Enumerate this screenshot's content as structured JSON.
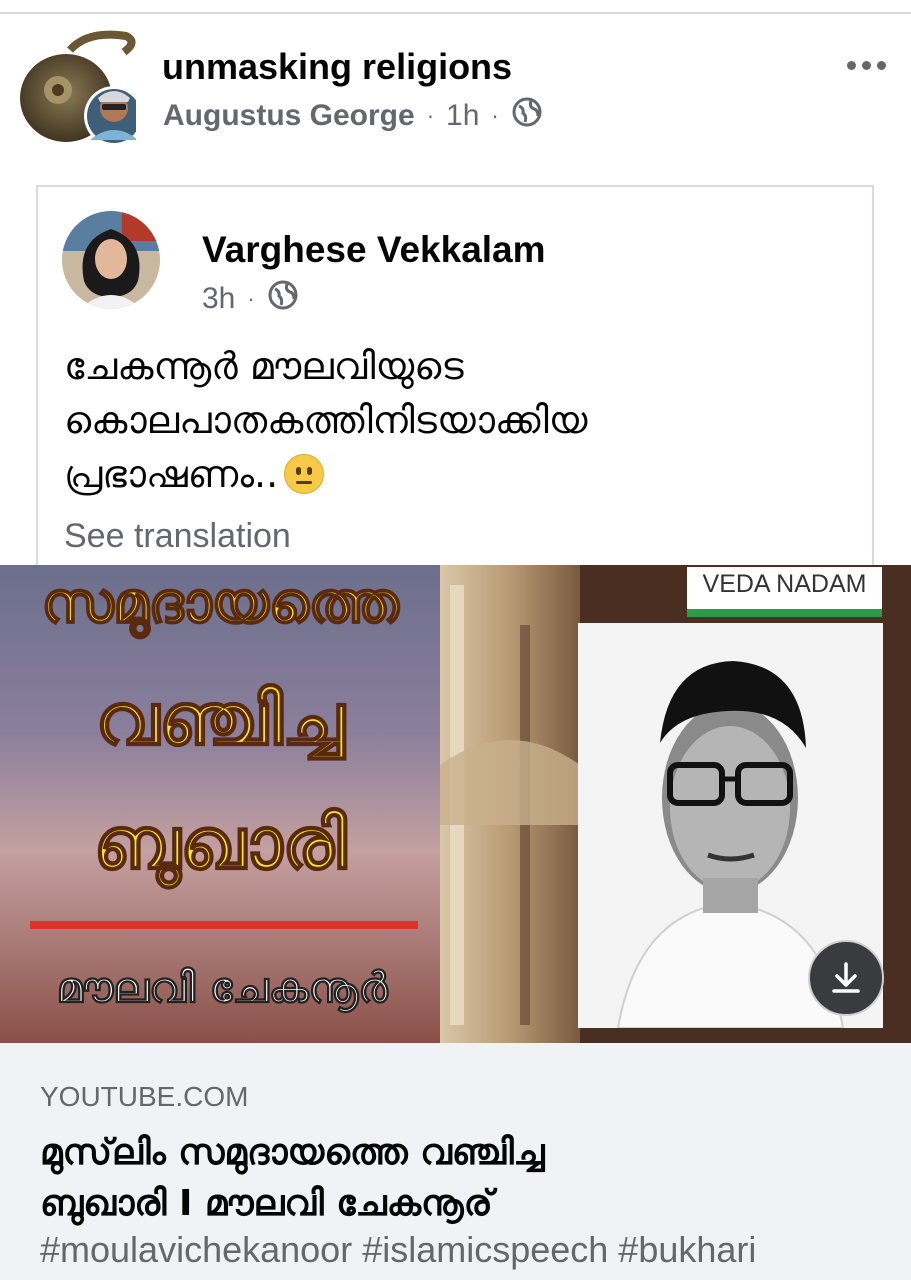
{
  "post": {
    "group_name": "unmasking religions",
    "author": "Augustus George",
    "time": "1h",
    "separator": "·"
  },
  "shared": {
    "name": "Varghese Vekkalam",
    "time": "3h",
    "separator": "·",
    "text_lines": [
      "ചേകന്നൂർ മൗലവിയുടെ",
      "കൊലപാതകത്തിനിടയാക്കിയ",
      "പ്രഭാഷണം.."
    ],
    "see_translation": "See translation"
  },
  "thumbnail": {
    "title_lines": [
      "സമുദായത്തെ",
      "വഞ്ചിച്ച",
      "ബുഖാരി"
    ],
    "subtitle": "മൗലവി ചേകനൂർ",
    "badge": "VEDA NADAM"
  },
  "link": {
    "domain": "YOUTUBE.COM",
    "title_lines": [
      "മുസ്‌ലിം സമുദായത്തെ വഞ്ചിച്ച",
      "ബുഖാരി I മൗലവി ചേകനൂര്"
    ],
    "hashtags": "#moulavichekanoor #islamicspeech #bukhari"
  },
  "icons": {
    "privacy": "globe-icon",
    "more": "more-options-icon",
    "download": "download-icon",
    "reaction": "neutral-face-emoji"
  },
  "colors": {
    "secondary_text": "#65676b",
    "thumb_title": "#ffe81a",
    "badge_green": "#2e9b4a",
    "link_bg": "#f0f2f5"
  }
}
